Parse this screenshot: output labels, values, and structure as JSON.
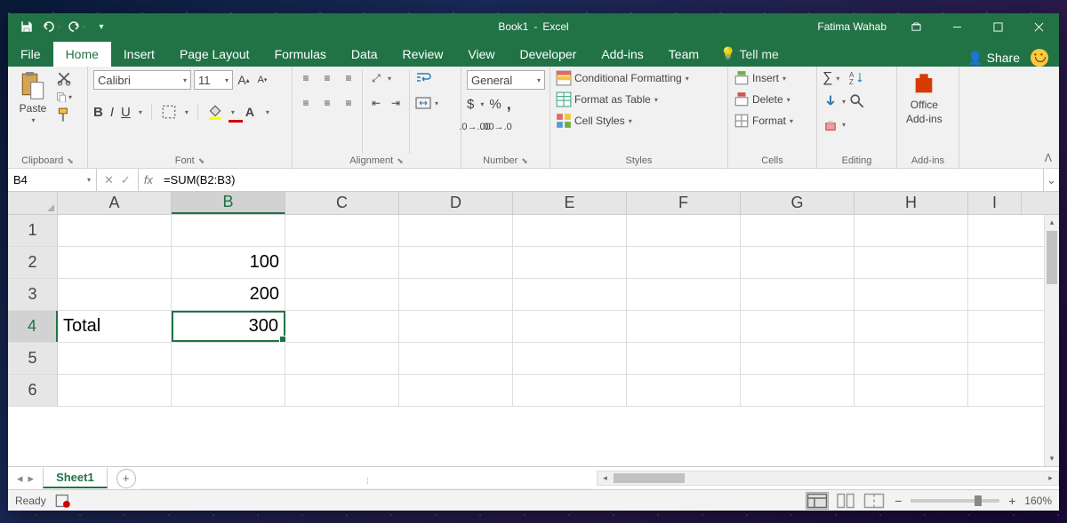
{
  "title": {
    "doc": "Book1",
    "app": "Excel"
  },
  "user": "Fatima Wahab",
  "tabs": [
    "File",
    "Home",
    "Insert",
    "Page Layout",
    "Formulas",
    "Data",
    "Review",
    "View",
    "Developer",
    "Add-ins",
    "Team"
  ],
  "active_tab": "Home",
  "tell_me": "Tell me",
  "share": "Share",
  "ribbon": {
    "clipboard": {
      "label": "Clipboard",
      "paste": "Paste"
    },
    "font": {
      "label": "Font",
      "name": "Calibri",
      "size": "11"
    },
    "alignment": {
      "label": "Alignment"
    },
    "number": {
      "label": "Number",
      "format": "General"
    },
    "styles": {
      "label": "Styles",
      "conditional": "Conditional Formatting",
      "table": "Format as Table",
      "cell": "Cell Styles"
    },
    "cells": {
      "label": "Cells",
      "insert": "Insert",
      "delete": "Delete",
      "format": "Format"
    },
    "editing": {
      "label": "Editing"
    },
    "addins": {
      "label": "Add-ins",
      "office": "Office",
      "office2": "Add-ins"
    }
  },
  "namebox": "B4",
  "formula": "=SUM(B2:B3)",
  "columns": [
    "A",
    "B",
    "C",
    "D",
    "E",
    "F",
    "G",
    "H",
    "I"
  ],
  "selected_col": "B",
  "selected_row": 4,
  "rows": [
    {
      "n": 1,
      "A": "",
      "B": ""
    },
    {
      "n": 2,
      "A": "",
      "B": "100"
    },
    {
      "n": 3,
      "A": "",
      "B": "200"
    },
    {
      "n": 4,
      "A": "Total",
      "B": "300"
    },
    {
      "n": 5,
      "A": "",
      "B": ""
    },
    {
      "n": 6,
      "A": "",
      "B": ""
    }
  ],
  "sheet": "Sheet1",
  "status": "Ready",
  "zoom": "160%"
}
